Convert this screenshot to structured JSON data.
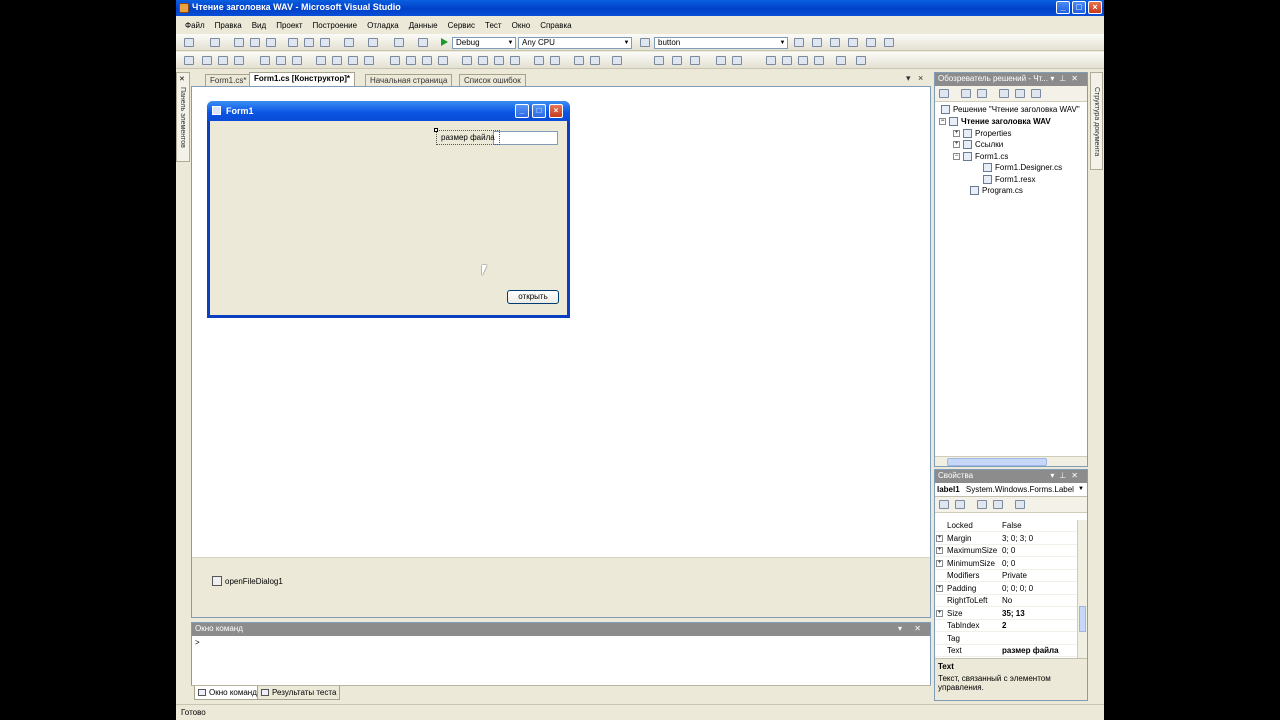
{
  "window": {
    "title": "Чтение заголовка WAV - Microsoft Visual Studio",
    "minimize": "_",
    "maximize": "□",
    "close": "×"
  },
  "menu": [
    "Файл",
    "Правка",
    "Вид",
    "Проект",
    "Построение",
    "Отладка",
    "Данные",
    "Сервис",
    "Тест",
    "Окно",
    "Справка"
  ],
  "toolbar": {
    "config": "Debug",
    "platform": "Any CPU",
    "find_value": "button"
  },
  "toolbox_strip": "Панель элементов",
  "doc_strip": "Структура документа",
  "tabs": [
    {
      "label": "Form1.cs*",
      "active": false
    },
    {
      "label": "Form1.cs [Конструктор]*",
      "active": true
    },
    {
      "label": "Начальная страница",
      "active": false
    },
    {
      "label": "Список ошибок",
      "active": false
    }
  ],
  "doc_close": "× ",
  "designer": {
    "form_title": "Form1",
    "label_text": "размер файла",
    "button_text": "открыть",
    "tray_component": "openFileDialog1"
  },
  "command_window": {
    "title": "Окно команд",
    "prompt": ">",
    "buttons": "▾ ✕"
  },
  "bottom_tabs": [
    "Окно команд",
    "Результаты теста"
  ],
  "status": "Готово",
  "solution_explorer": {
    "title": "Обозреватель решений - Чт...",
    "solution": "Решение \"Чтение заголовка WAV\"",
    "project": "Чтение заголовка WAV",
    "properties": "Properties",
    "references": "Ссылки",
    "form": "Form1.cs",
    "designer_file": "Form1.Designer.cs",
    "resx_file": "Form1.resx",
    "program": "Program.cs"
  },
  "properties": {
    "title": "Свойства",
    "object_name": "label1",
    "object_type": "System.Windows.Forms.Label",
    "rows": [
      {
        "name": "Locked",
        "value": "False",
        "expandable": false,
        "bold": false
      },
      {
        "name": "Margin",
        "value": "3; 0; 3; 0",
        "expandable": true,
        "bold": false
      },
      {
        "name": "MaximumSize",
        "value": "0; 0",
        "expandable": true,
        "bold": false
      },
      {
        "name": "MinimumSize",
        "value": "0; 0",
        "expandable": true,
        "bold": false
      },
      {
        "name": "Modifiers",
        "value": "Private",
        "expandable": false,
        "bold": false
      },
      {
        "name": "Padding",
        "value": "0; 0; 0; 0",
        "expandable": true,
        "bold": false
      },
      {
        "name": "RightToLeft",
        "value": "No",
        "expandable": false,
        "bold": false
      },
      {
        "name": "Size",
        "value": "35; 13",
        "expandable": true,
        "bold": true
      },
      {
        "name": "TabIndex",
        "value": "2",
        "expandable": false,
        "bold": true
      },
      {
        "name": "Tag",
        "value": "",
        "expandable": false,
        "bold": false
      },
      {
        "name": "Text",
        "value": "размер файла",
        "expandable": false,
        "bold": true
      }
    ],
    "desc_title": "Text",
    "desc_text": "Текст, связанный с элементом управления."
  }
}
